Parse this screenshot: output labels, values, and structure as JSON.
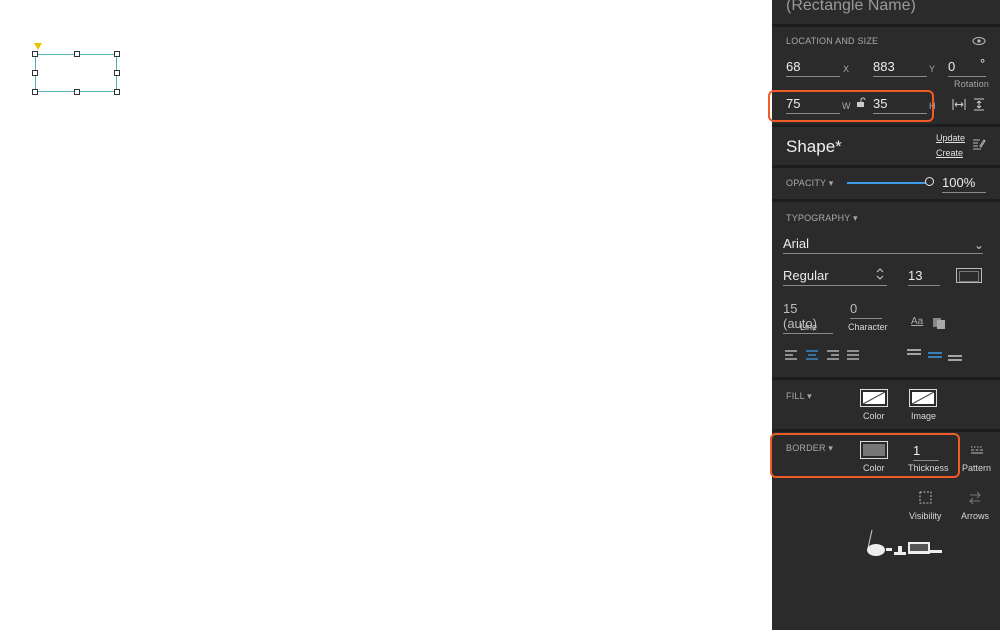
{
  "panel": {
    "element_name_placeholder": "(Rectangle Name)",
    "location_size": {
      "section_label": "LOCATION AND SIZE",
      "x_value": "68",
      "x_label": "X",
      "y_value": "883",
      "y_label": "Y",
      "rotation_value": "0",
      "rotation_unit": "°",
      "rotation_label": "Rotation",
      "w_value": "75",
      "w_label": "W",
      "h_value": "35",
      "h_label": "H"
    },
    "shape": {
      "title": "Shape*",
      "update_link": "Update",
      "create_link": "Create"
    },
    "opacity": {
      "label": "OPACITY ▾",
      "value": "100%",
      "level": 1.0
    },
    "typography": {
      "label": "TYPOGRAPHY ▾",
      "font": "Arial",
      "weight": "Regular",
      "size": "13",
      "line_value": "15 (auto)",
      "line_label": "Line",
      "character_value": "0",
      "character_label": "Character"
    },
    "fill": {
      "label": "FILL ▾",
      "color_label": "Color",
      "image_label": "Image"
    },
    "border": {
      "label": "BORDER ▾",
      "color_label": "Color",
      "thickness_value": "1",
      "thickness_label": "Thickness",
      "pattern_label": "Pattern",
      "visibility_label": "Visibility",
      "arrows_label": "Arrows"
    }
  },
  "colors": {
    "panel_bg": "#2b2b2b",
    "highlight": "#ef5a28",
    "accent": "#3b9be8",
    "selection": "#4fb3b3"
  }
}
